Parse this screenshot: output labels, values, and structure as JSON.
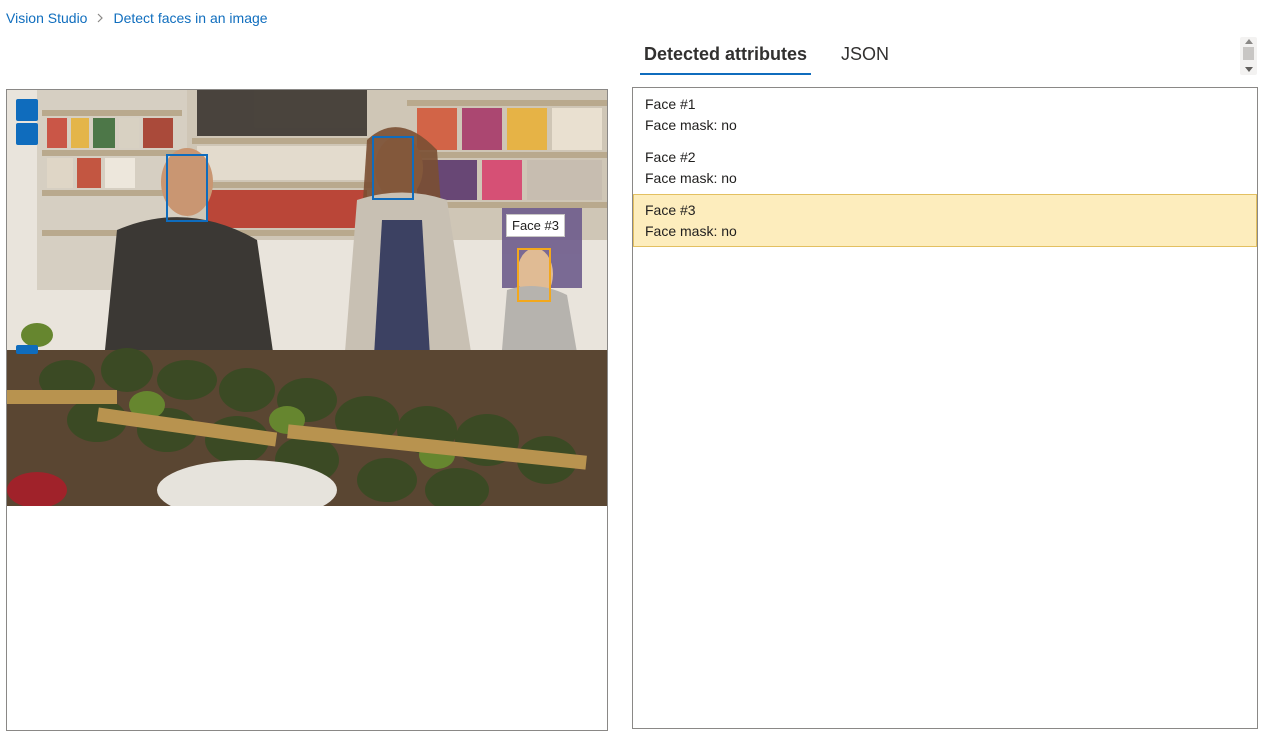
{
  "breadcrumb": {
    "root": "Vision Studio",
    "current": "Detect faces in an image"
  },
  "tabs": [
    {
      "label": "Detected attributes",
      "active": true
    },
    {
      "label": "JSON",
      "active": false
    }
  ],
  "image": {
    "description_icon": "photo-icon",
    "tooltip": "Face #3",
    "faces": [
      {
        "label": "Face #1",
        "active": false
      },
      {
        "label": "Face #2",
        "active": false
      },
      {
        "label": "Face #3",
        "active": true
      }
    ]
  },
  "results": {
    "faces": [
      {
        "title": "Face #1",
        "mask": "Face mask: no",
        "selected": false
      },
      {
        "title": "Face #2",
        "mask": "Face mask: no",
        "selected": false
      },
      {
        "title": "Face #3",
        "mask": "Face mask: no",
        "selected": true
      }
    ]
  },
  "colors": {
    "accent": "#0f6cbd",
    "active_box": "#f3a81c",
    "selected_bg": "#fdedbd"
  }
}
